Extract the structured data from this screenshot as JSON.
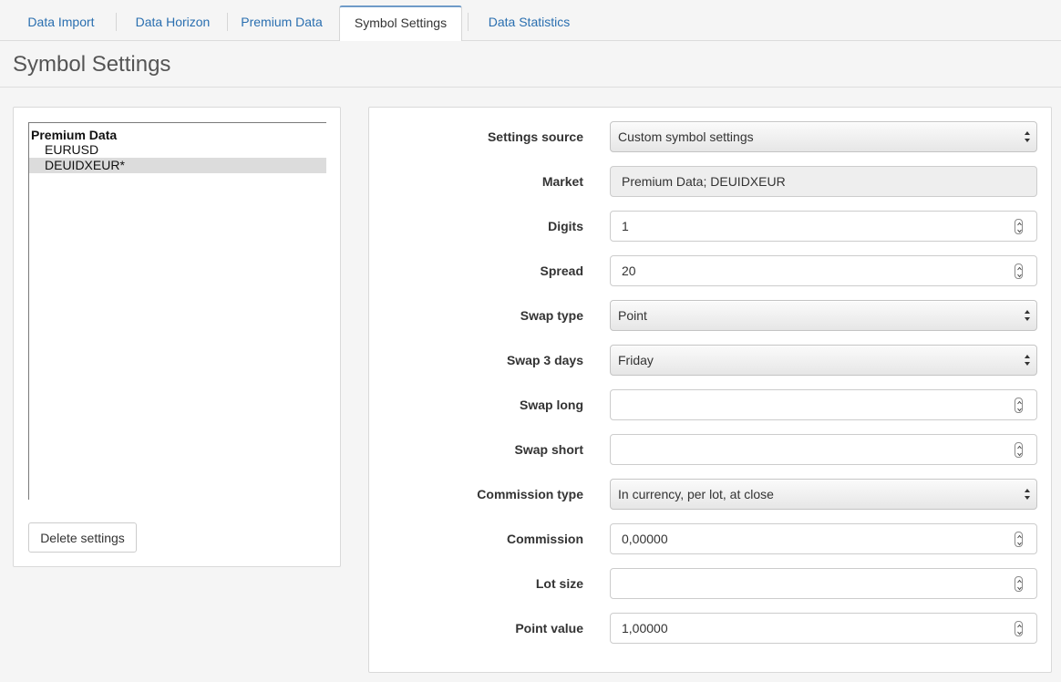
{
  "tabs": [
    {
      "label": "Data Import",
      "active": false
    },
    {
      "label": "Data Horizon",
      "active": false
    },
    {
      "label": "Premium Data",
      "active": false
    },
    {
      "label": "Symbol Settings",
      "active": true
    },
    {
      "label": "Data Statistics",
      "active": false
    }
  ],
  "page": {
    "title": "Symbol Settings"
  },
  "tree": {
    "group": "Premium Data",
    "items": [
      {
        "label": "EURUSD",
        "selected": false
      },
      {
        "label": "DEUIDXEUR*",
        "selected": true
      }
    ]
  },
  "delete_button": "Delete settings",
  "form": {
    "settings_source": {
      "label": "Settings source",
      "value": "Custom symbol settings"
    },
    "market": {
      "label": "Market",
      "value": "Premium Data; DEUIDXEUR"
    },
    "digits": {
      "label": "Digits",
      "value": "1"
    },
    "spread": {
      "label": "Spread",
      "value": "20"
    },
    "swap_type": {
      "label": "Swap type",
      "value": "Point"
    },
    "swap_3_days": {
      "label": "Swap 3 days",
      "value": "Friday"
    },
    "swap_long": {
      "label": "Swap long",
      "value": ""
    },
    "swap_short": {
      "label": "Swap short",
      "value": ""
    },
    "commission_type": {
      "label": "Commission type",
      "value": "In currency, per lot, at close"
    },
    "commission": {
      "label": "Commission",
      "value": "0,00000"
    },
    "lot_size": {
      "label": "Lot size",
      "value": ""
    },
    "point_value": {
      "label": "Point value",
      "value": "1,00000"
    }
  },
  "colors": {
    "link": "#2a6fb0",
    "tab_active_top": "#6f9bc8",
    "selected_row": "#dcdcdc"
  }
}
